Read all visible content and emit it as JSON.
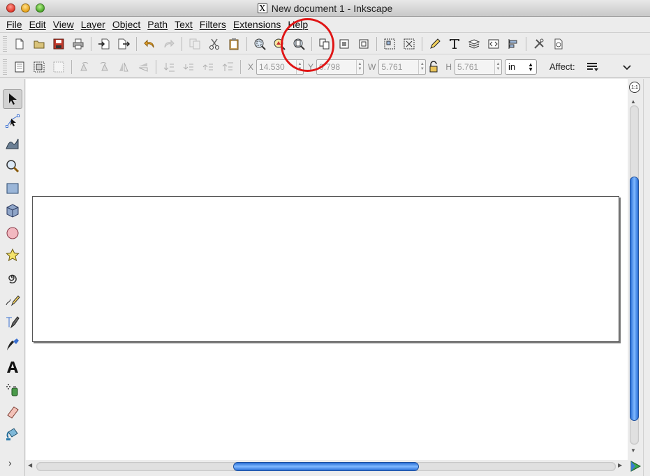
{
  "window": {
    "title": "New document 1 - Inkscape",
    "x_logo": "X"
  },
  "menu": [
    "File",
    "Edit",
    "View",
    "Layer",
    "Object",
    "Path",
    "Text",
    "Filters",
    "Extensions",
    "Help"
  ],
  "controls": {
    "x_label": "X",
    "x_value": "14.530",
    "y_label": "Y",
    "y_value": "0.798",
    "w_label": "W",
    "w_value": "5.761",
    "h_label": "H",
    "h_value": "5.761",
    "unit": "in",
    "affect_label": "Affect:"
  },
  "toolbox_more": "›",
  "zoom_corner_label": "1:1",
  "scroll": {
    "vertical_position": 0.21,
    "vertical_visible": 0.72,
    "horizontal_position": 0.34,
    "horizontal_visible": 0.32
  },
  "colors": {
    "accent": "#2a6fd6",
    "highlight": "#e01515"
  }
}
